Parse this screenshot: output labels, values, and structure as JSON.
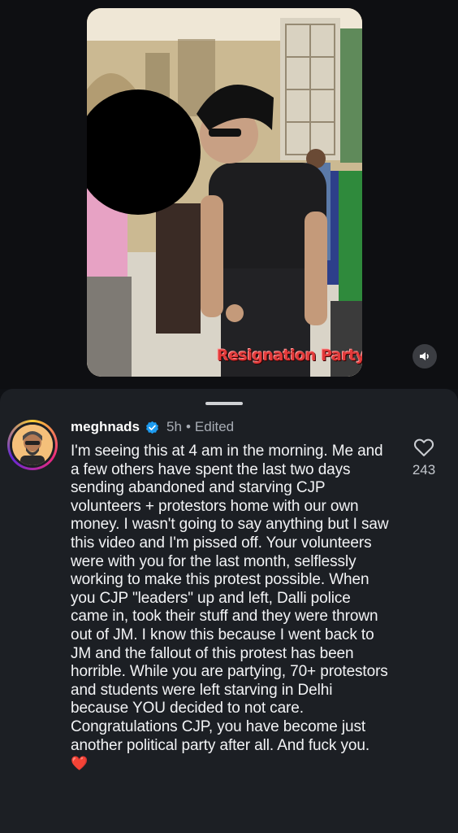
{
  "media": {
    "caption": "Resignation Party",
    "sound_icon": "speaker-icon"
  },
  "comment": {
    "username": "meghnads",
    "verified_icon": "verified-badge-icon",
    "time": "5h",
    "separator": "•",
    "edited": "Edited",
    "text": "I'm seeing this at 4 am in the morning. Me and a few others have spent the last two days sending abandoned and starving CJP volunteers + protestors home with our own money. I wasn't going to say anything but I saw this video and I'm pissed off. Your volunteers were with you for the last month, selflessly working to make this protest possible. When you CJP \"leaders\" up and left, Dalli police came in, took their stuff and they were thrown out of JM. I know this because I went back to JM and the fallout of this protest has been horrible. While you are partying, 70+ protestors and students were left starving in Delhi because YOU decided to not care. Congratulations CJP, you have become just another political party after all. And fuck you.",
    "heart_emoji": "❤️",
    "like_icon": "heart-outline-icon",
    "like_count": "243"
  },
  "colors": {
    "background": "#0f1115",
    "sheet": "#1c1f24",
    "verified": "#1d9bf0",
    "caption_red": "#e23a3a"
  }
}
